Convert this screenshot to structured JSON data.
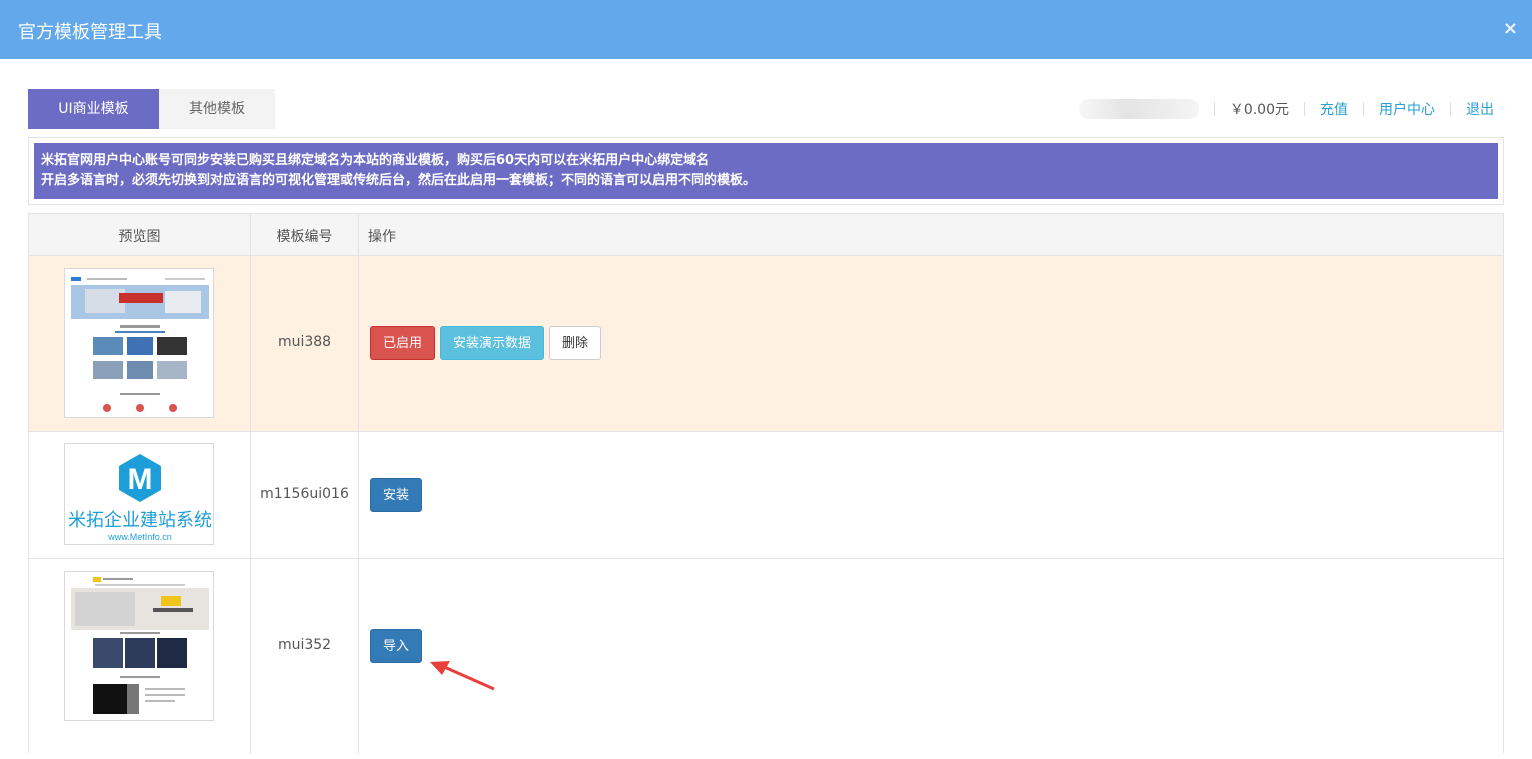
{
  "window": {
    "title": "官方模板管理工具",
    "close_glyph": "×"
  },
  "tabs": [
    {
      "label": "UI商业模板",
      "active": true
    },
    {
      "label": "其他模板",
      "active": false
    }
  ],
  "userbar": {
    "balance": "￥0.00元",
    "links": {
      "recharge": "充值",
      "user_center": "用户中心",
      "logout": "退出"
    }
  },
  "notice": {
    "line1": "米拓官网用户中心账号可同步安装已购买且绑定域名为本站的商业模板，购买后60天内可以在米拓用户中心绑定域名",
    "line2": "开启多语言时，必须先切换到对应语言的可视化管理或传统后台，然后在此启用一套模板；不同的语言可以启用不同的模板。"
  },
  "table": {
    "headers": {
      "preview": "预览图",
      "code": "模板编号",
      "actions": "操作"
    },
    "rows": [
      {
        "code": "mui388",
        "buttons": [
          "已启用",
          "安装演示数据",
          "删除"
        ]
      },
      {
        "code": "m1156ui016",
        "buttons": [
          "安装"
        ],
        "thumb_text": {
          "brand": "米拓企业建站系统",
          "url": "www.MetInfo.cn"
        }
      },
      {
        "code": "mui352",
        "buttons": [
          "导入"
        ]
      }
    ]
  },
  "colors": {
    "titlebar": "#62a8ea",
    "tab_active": "#6c6cc4",
    "notice": "#6c6cc4",
    "row_highlight": "#fef1e2",
    "link": "#2a9fd6",
    "arrow": "#e8403a"
  }
}
